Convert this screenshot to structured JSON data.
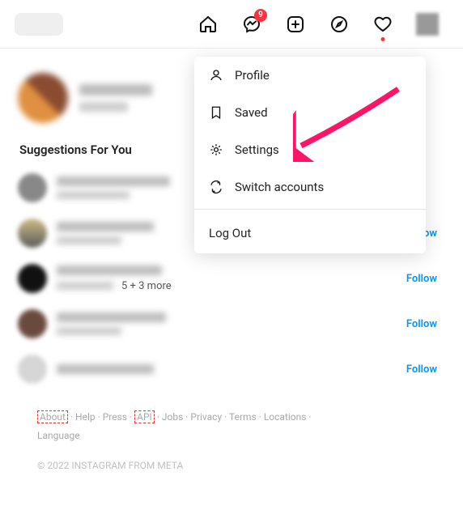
{
  "nav": {
    "badge_count": "9"
  },
  "suggestions_title": "Suggestions For You",
  "follow_label": "Follow",
  "more_text": "5 + 3 more",
  "dropdown": {
    "profile": "Profile",
    "saved": "Saved",
    "settings": "Settings",
    "switch": "Switch accounts",
    "logout": "Log Out"
  },
  "footer": {
    "about": "About",
    "help": "Help",
    "press": "Press",
    "api": "API",
    "jobs": "Jobs",
    "privacy": "Privacy",
    "terms": "Terms",
    "locations": "Locations",
    "language": "Language",
    "copyright": "© 2022 INSTAGRAM FROM META"
  }
}
